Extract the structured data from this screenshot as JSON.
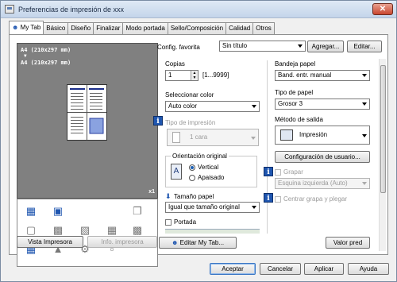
{
  "window": {
    "title": "Preferencias de impresión de xxx",
    "close_label": "✕"
  },
  "tabs": [
    "My Tab",
    "Básico",
    "Diseño",
    "Finalizar",
    "Modo portada",
    "Sello/Composición",
    "Calidad",
    "Otros"
  ],
  "preview": {
    "paper_line1": "A4 (210x297 mm)",
    "arrow": "▼",
    "paper_line2": "A4 (210x297 mm)",
    "copies_badge": "x1"
  },
  "left_buttons": {
    "vista_impresora": "Vista Impresora",
    "info_impresora": "Info. impresora"
  },
  "config": {
    "label": "Config. favorita",
    "value": "Sin título",
    "add_label": "Agregar...",
    "edit_label": "Editar..."
  },
  "copias": {
    "label": "Copias",
    "value": "1",
    "range": "[1...9999]"
  },
  "color": {
    "label": "Seleccionar color",
    "value": "Auto color"
  },
  "tipo_impresion": {
    "label": "Tipo de impresión",
    "value": "1 cara"
  },
  "orientacion": {
    "label": "Orientación original",
    "vertical": "Vertical",
    "apaisado": "Apaisado",
    "page_letter": "A"
  },
  "tamano": {
    "label": "Tamaño papel",
    "value": "Igual que tamaño original"
  },
  "portada": {
    "label": "Portada"
  },
  "bandeja": {
    "label": "Bandeja papel",
    "value": "Band. entr. manual"
  },
  "tipo_papel": {
    "label": "Tipo de papel",
    "value": "Grosor 3"
  },
  "metodo": {
    "label": "Método de salida",
    "value": "Impresión"
  },
  "config_usuario": {
    "label": "Configuración de usuario..."
  },
  "grapar": {
    "label": "Grapar",
    "value": "Esquina izquierda (Auto)"
  },
  "centrar": {
    "label": "Centrar grapa y plegar"
  },
  "bottom_panel": {
    "edit_mytab": "Editar My Tab...",
    "valor_pred": "Valor pred"
  },
  "footer": {
    "aceptar": "Aceptar",
    "cancelar": "Cancelar",
    "aplicar": "Aplicar",
    "ayuda": "Ayuda"
  },
  "colors": {
    "accent": "#1f56b0",
    "preview_bg": "#808080",
    "titlebar": "#c4d5ea"
  }
}
